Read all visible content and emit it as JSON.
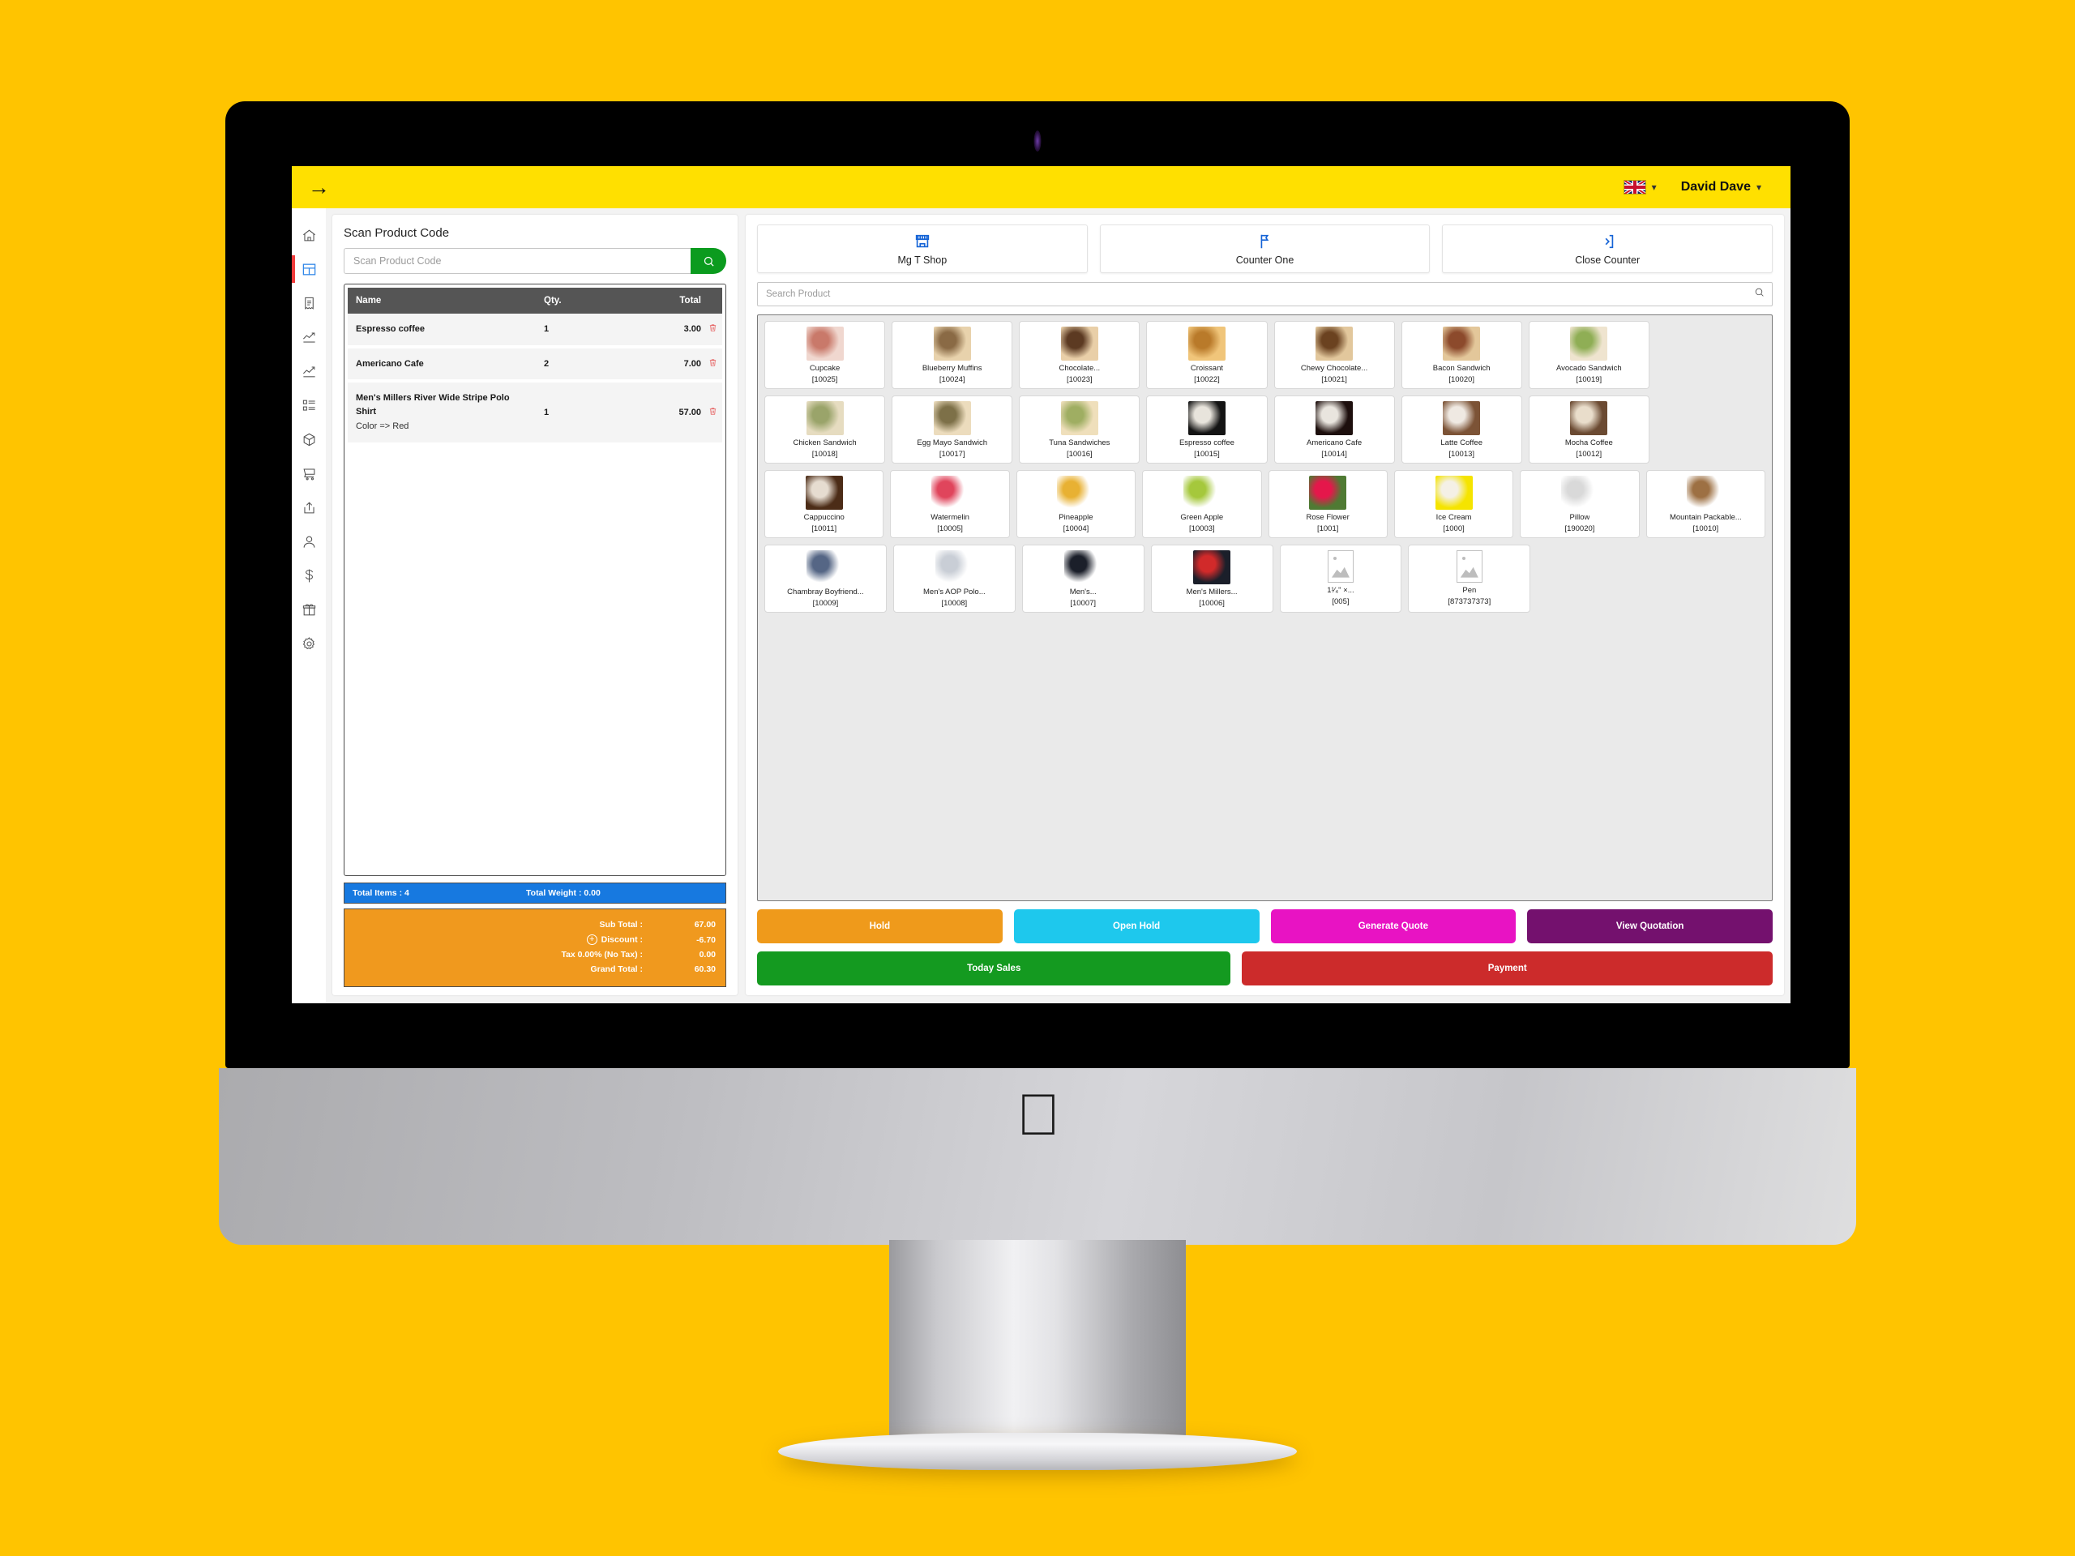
{
  "topbar": {
    "menu_icon": "arrow-right-icon",
    "language_flag": "uk-flag-icon",
    "user_name": "David Dave"
  },
  "sidebar": {
    "items": [
      {
        "name": "home",
        "icon": "home-icon",
        "active": false
      },
      {
        "name": "pos",
        "icon": "layout-dashboard-icon",
        "active": true
      },
      {
        "name": "invoices",
        "icon": "receipt-icon",
        "active": false
      },
      {
        "name": "reports",
        "icon": "trend-chart-icon",
        "active": false
      },
      {
        "name": "analytics",
        "icon": "line-chart-icon",
        "active": false
      },
      {
        "name": "lists",
        "icon": "list-blocks-icon",
        "active": false
      },
      {
        "name": "products",
        "icon": "box-icon",
        "active": false
      },
      {
        "name": "purchases",
        "icon": "shopping-cart-icon",
        "active": false
      },
      {
        "name": "transfers",
        "icon": "share-icon",
        "active": false
      },
      {
        "name": "customers",
        "icon": "user-icon",
        "active": false
      },
      {
        "name": "expenses",
        "icon": "dollar-icon",
        "active": false
      },
      {
        "name": "gift-cards",
        "icon": "gift-icon",
        "active": false
      },
      {
        "name": "settings",
        "icon": "gear-icon",
        "active": false
      }
    ]
  },
  "left_panel": {
    "scan_label": "Scan Product Code",
    "scan_placeholder": "Scan Product Code",
    "scan_button_icon": "search-icon",
    "cart_headers": {
      "name": "Name",
      "qty": "Qty.",
      "total": "Total"
    },
    "cart_rows": [
      {
        "name": "Espresso coffee",
        "sub": "",
        "qty": "1",
        "total": "3.00",
        "delete_icon": "trash-icon"
      },
      {
        "name": "Americano Cafe",
        "sub": "",
        "qty": "2",
        "total": "7.00",
        "delete_icon": "trash-icon"
      },
      {
        "name": "Men's Millers River Wide Stripe Polo Shirt",
        "sub": "Color => Red",
        "qty": "1",
        "total": "57.00",
        "delete_icon": "trash-icon"
      }
    ],
    "totals_bar": {
      "items_label": "Total Items : 4",
      "weight_label": "Total Weight : 0.00"
    },
    "totals": [
      {
        "label": "Sub Total :",
        "value": "67.00",
        "has_plus": false
      },
      {
        "label": "Discount :",
        "value": "-6.70",
        "has_plus": true
      },
      {
        "label": "Tax 0.00% (No Tax) :",
        "value": "0.00",
        "has_plus": false
      },
      {
        "label": "Grand Total :",
        "value": "60.30",
        "has_plus": false
      }
    ]
  },
  "right_panel": {
    "counters": [
      {
        "label": "Mg T Shop",
        "icon": "store-icon"
      },
      {
        "label": "Counter One",
        "icon": "flag-icon"
      },
      {
        "label": "Close Counter",
        "icon": "exit-door-icon"
      }
    ],
    "search_placeholder": "Search Product",
    "search_icon": "search-icon",
    "product_rows": [
      [
        {
          "name": "Cupcake",
          "code": "[10025]",
          "thumb": "cupcakes",
          "c1": "#f0d7cf",
          "c2": "#c9796a"
        },
        {
          "name": "Blueberry Muffins",
          "code": "[10024]",
          "thumb": "muffins",
          "c1": "#e8d2ac",
          "c2": "#8a6a45"
        },
        {
          "name": "Chocolate...",
          "code": "[10023]",
          "thumb": "chocolate-pastry",
          "c1": "#e9cfa8",
          "c2": "#5c3a22"
        },
        {
          "name": "Croissant",
          "code": "[10022]",
          "thumb": "croissant",
          "c1": "#f0c57a",
          "c2": "#b97a2a"
        },
        {
          "name": "Chewy Chocolate...",
          "code": "[10021]",
          "thumb": "cookies",
          "c1": "#e2c79c",
          "c2": "#6b4220"
        },
        {
          "name": "Bacon Sandwich",
          "code": "[10020]",
          "thumb": "bacon-sandwich",
          "c1": "#e3c79a",
          "c2": "#8c4a2c"
        },
        {
          "name": "Avocado Sandwich",
          "code": "[10019]",
          "thumb": "avocado-sandwich",
          "c1": "#efe4cf",
          "c2": "#8fae55"
        }
      ],
      [
        {
          "name": "Chicken Sandwich",
          "code": "[10018]",
          "thumb": "chicken-sandwich",
          "c1": "#e6dcc0",
          "c2": "#9aa46a"
        },
        {
          "name": "Egg Mayo Sandwich",
          "code": "[10017]",
          "thumb": "egg-mayo-sandwich",
          "c1": "#ecdcbd",
          "c2": "#7d7048"
        },
        {
          "name": "Tuna Sandwiches",
          "code": "[10016]",
          "thumb": "tuna-sandwich",
          "c1": "#efdfbb",
          "c2": "#9fae62"
        },
        {
          "name": "Espresso coffee",
          "code": "[10015]",
          "thumb": "espresso-cup",
          "c1": "#141414",
          "c2": "#e8e4dc"
        },
        {
          "name": "Americano Cafe",
          "code": "[10014]",
          "thumb": "americano-cup",
          "c1": "#1d0f0d",
          "c2": "#e9e5de"
        },
        {
          "name": "Latte Coffee",
          "code": "[10013]",
          "thumb": "latte-cup",
          "c1": "#7c5336",
          "c2": "#efe9e2"
        },
        {
          "name": "Mocha Coffee",
          "code": "[10012]",
          "thumb": "mocha-cup",
          "c1": "#6b4a32",
          "c2": "#e9ddcb"
        }
      ],
      [
        {
          "name": "Cappuccino",
          "code": "[10011]",
          "thumb": "cappuccino-cup",
          "c1": "#4c2c17",
          "c2": "#e6dcd0"
        },
        {
          "name": "Watermelin",
          "code": "[10005]",
          "thumb": "watermelon",
          "c1": "#ffffff",
          "c2": "#e0455c"
        },
        {
          "name": "Pineapple",
          "code": "[10004]",
          "thumb": "pineapple",
          "c1": "#ffffff",
          "c2": "#e8b133"
        },
        {
          "name": "Green Apple",
          "code": "[10003]",
          "thumb": "green-apple",
          "c1": "#ffffff",
          "c2": "#a5c83c"
        },
        {
          "name": "Rose Flower",
          "code": "[1001]",
          "thumb": "rose",
          "c1": "#4f7a33",
          "c2": "#e5174b"
        },
        {
          "name": "Ice Cream",
          "code": "[1000]",
          "thumb": "ice-cream-cone",
          "c1": "#f5e400",
          "c2": "#f4f0e6"
        },
        {
          "name": "Pillow",
          "code": "[190020]",
          "thumb": "pillow",
          "c1": "#ffffff",
          "c2": "#d9d9d9"
        },
        {
          "name": "Mountain Packable...",
          "code": "[10010]",
          "thumb": "brown-jacket",
          "c1": "#ffffff",
          "c2": "#9d7043"
        }
      ],
      [
        {
          "name": "Chambray Boyfriend...",
          "code": "[10009]",
          "thumb": "denim-shirt",
          "c1": "#ffffff",
          "c2": "#556685"
        },
        {
          "name": "Men's AOP Polo...",
          "code": "[10008]",
          "thumb": "white-polo",
          "c1": "#ffffff",
          "c2": "#c9ced6"
        },
        {
          "name": "Men's...",
          "code": "[10007]",
          "thumb": "black-polo",
          "c1": "#ffffff",
          "c2": "#1b1f2a"
        },
        {
          "name": "Men's Millers...",
          "code": "[10006]",
          "thumb": "striped-polo",
          "c1": "#1b1f2a",
          "c2": "#d12a2a"
        },
        {
          "name": "1¹⁄₄\" ×...",
          "code": "[005]",
          "thumb": "image-placeholder",
          "placeholder": true
        },
        {
          "name": "Pen",
          "code": "[873737373]",
          "thumb": "image-placeholder",
          "placeholder": true
        }
      ]
    ],
    "actions_row1": [
      {
        "label": "Hold",
        "color": "#ef9a1b"
      },
      {
        "label": "Open Hold",
        "color": "#1ec8ed"
      },
      {
        "label": "Generate Quote",
        "color": "#e813c3"
      },
      {
        "label": "View Quotation",
        "color": "#74116e"
      }
    ],
    "actions_row2": [
      {
        "label": "Today Sales",
        "color": "#149a20",
        "flex": 1
      },
      {
        "label": "Payment",
        "color": "#cc2b2b",
        "flex": 1.12
      }
    ]
  },
  "colors": {
    "page_background": "#FFC400",
    "topbar": "#FFE000",
    "accent_blue": "#1779e0",
    "totals_orange": "#f0991e",
    "scan_green": "#0b9b1e"
  }
}
